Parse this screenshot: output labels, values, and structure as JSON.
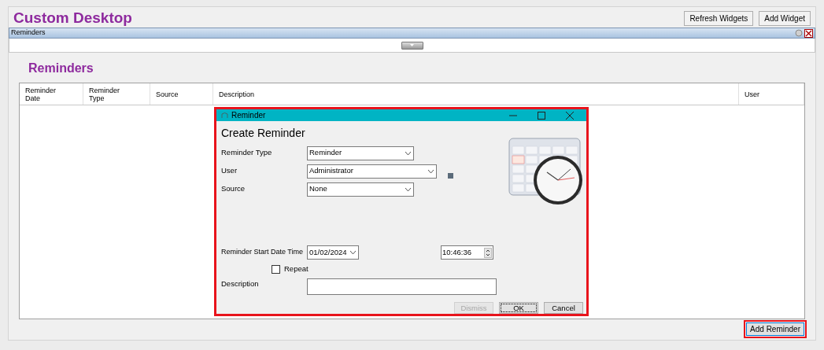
{
  "page": {
    "title": "Custom Desktop"
  },
  "header_buttons": [
    {
      "label": "Refresh Widgets"
    },
    {
      "label": "Add Widget"
    }
  ],
  "widget": {
    "title": "Reminders",
    "heading": "Reminders",
    "expanded": true
  },
  "table": {
    "columns": [
      "Reminder Date",
      "Reminder Type",
      "Source",
      "Description",
      "User"
    ]
  },
  "dialog": {
    "title": "Reminder",
    "heading": "Create Reminder",
    "highlighted": true,
    "fields": [
      {
        "label": "Reminder Type",
        "value": "Reminder",
        "kind": "dropdown"
      },
      {
        "label": "User",
        "value": "Administrator",
        "kind": "dropdown_wide"
      },
      {
        "label": "Source",
        "value": "None",
        "kind": "dropdown"
      }
    ],
    "start": {
      "label": "Reminder Start Date Time",
      "date": "01/02/2024",
      "time": "10:46:36"
    },
    "repeat": {
      "label": "Repeat",
      "checked": false
    },
    "description": {
      "label": "Description"
    },
    "buttons": [
      {
        "label": "Dismiss",
        "disabled": true,
        "focused": false
      },
      {
        "label": "OK",
        "disabled": false,
        "focused": true
      },
      {
        "label": "Cancel",
        "disabled": false,
        "focused": false
      }
    ]
  },
  "add_button": {
    "label": "Add Reminder",
    "highlighted": true
  }
}
